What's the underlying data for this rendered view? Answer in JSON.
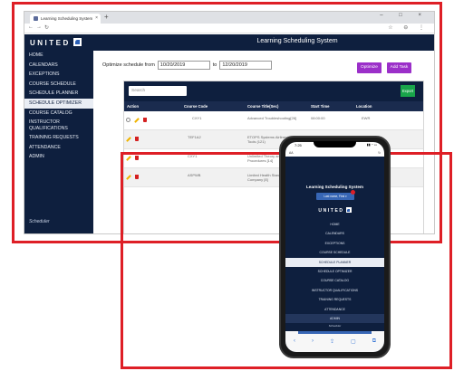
{
  "browser": {
    "tab_title": "Learning Scheduling System",
    "tab_close": "×",
    "new_tab": "+",
    "window_controls": "– □ ×",
    "nav_buttons": {
      "back": "←",
      "forward": "→",
      "reload": "↻"
    },
    "addr_right": "☆ ⊖ ⋮"
  },
  "app": {
    "brand": "UNITED",
    "title": "Learning Scheduling System",
    "sidebar": [
      {
        "label": "HOME"
      },
      {
        "label": "CALENDARS"
      },
      {
        "label": "EXCEPTIONS"
      },
      {
        "label": "COURSE SCHEDULE"
      },
      {
        "label": "SCHEDULE PLANNER"
      },
      {
        "label": "SCHEDULE OPTIMIZER"
      },
      {
        "label": "COURSE CATALOG"
      },
      {
        "label": "INSTRUCTOR QUALIFICATIONS"
      },
      {
        "label": "TRAINING REQUESTS"
      },
      {
        "label": "ATTENDANCE"
      },
      {
        "label": "ADMIN"
      }
    ],
    "sidebar_footer": "Scheduler"
  },
  "optimizer": {
    "label_from": "Optimize schedule from",
    "from_date": "10/20/2019",
    "label_to": "to",
    "to_date": "12/20/2019",
    "optimize_button": "Optimize",
    "add_task_button": "Add Task"
  },
  "table": {
    "search_placeholder": "Search",
    "export_button": "Export",
    "columns": [
      "Action",
      "Course Code",
      "Course Title(Sec)",
      "Start Time",
      "Location"
    ],
    "rows": [
      {
        "code": "CXY1",
        "title": "Advanced Troubleshooting[26]",
        "start": "08:00:00",
        "location": "EWR"
      },
      {
        "code": "TEF1A2",
        "title": "ETOPS Systems Airlines(1) Tools (121)",
        "start": "12:00:00",
        "location": "DEN"
      },
      {
        "code": "CXY1",
        "title": "Unlimited Theory and Procedures [14]",
        "start": "",
        "location": ""
      },
      {
        "code": "ASPWB",
        "title": "Limited Health Standards Airline Company [8]",
        "start": "",
        "location": ""
      }
    ]
  },
  "phone": {
    "time": "7:25",
    "status_right": "▮▮ ◔ ▭",
    "addr_left": "AA",
    "addr_right": "↻",
    "title": "Learning Scheduling System",
    "last_name": "Last name, First ▾",
    "brand": "UNITED",
    "nav": [
      {
        "label": "HOME"
      },
      {
        "label": "CALENDARS"
      },
      {
        "label": "EXCEPTIONS"
      },
      {
        "label": "COURSE SCHEDULE"
      },
      {
        "label": "SCHEDULE PLANNER"
      },
      {
        "label": "SCHEDULE OPTIMIZER"
      },
      {
        "label": "COURSE CATALOG"
      },
      {
        "label": "INSTRUCTOR QUALIFICATIONS"
      },
      {
        "label": "TRAINING REQUESTS"
      },
      {
        "label": "ATTENDANCE"
      },
      {
        "label": "ADMIN"
      }
    ],
    "footer": "Scheduler",
    "toolbar": [
      "‹",
      "›",
      "⇪",
      "▢",
      "⧉"
    ]
  },
  "colors": {
    "navy": "#0e1f3e",
    "purple": "#9b2fc9",
    "green": "#19a44a",
    "red_frame": "#de1f26",
    "phone_blue": "#3766b5"
  }
}
